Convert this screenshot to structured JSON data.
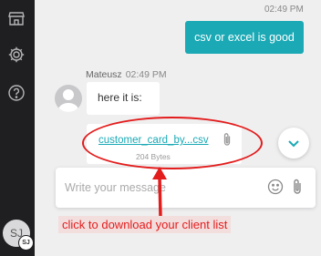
{
  "sidebar": {
    "icons": [
      "store-icon",
      "gear-icon",
      "help-icon"
    ],
    "user_initials": "SJ",
    "user_badge": "SJ"
  },
  "chat": {
    "outgoing": {
      "time": "02:49 PM",
      "text": "csv or excel is good"
    },
    "incoming": {
      "sender": "Mateusz",
      "time": "02:49 PM",
      "text": "here it is:",
      "attachment": {
        "file_name": "customer_card_by...csv",
        "file_size": "204 Bytes"
      }
    }
  },
  "composer": {
    "placeholder": "Write your message"
  },
  "annotation": {
    "text": "click to download your client list",
    "color": "#e31c1c"
  },
  "colors": {
    "accent": "#1aa9b5",
    "sidebar": "#1f1f21"
  }
}
